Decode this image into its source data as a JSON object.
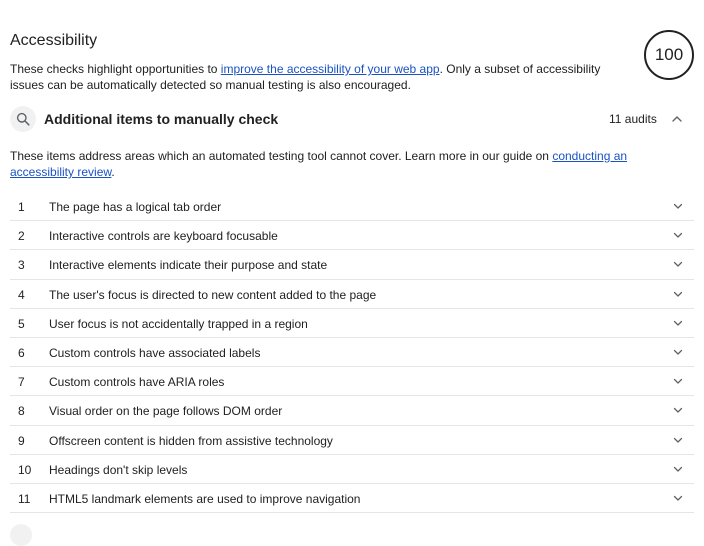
{
  "category": {
    "title": "Accessibility",
    "description_pre": "These checks highlight opportunities to ",
    "description_link": "improve the accessibility of your web app",
    "description_post": ". Only a subset of accessibility issues can be automatically detected so manual testing is also encouraged.",
    "score": "100",
    "score_color": "#212121"
  },
  "group": {
    "icon": "search-icon",
    "title": "Additional items to manually check",
    "count_label": "11 audits",
    "expanded": true,
    "description_pre": "These items address areas which an automated testing tool cannot cover. Learn more in our guide on ",
    "description_link": "conducting an accessibility review",
    "description_post": "."
  },
  "audits": [
    {
      "num": "1",
      "title": "The page has a logical tab order"
    },
    {
      "num": "2",
      "title": "Interactive controls are keyboard focusable"
    },
    {
      "num": "3",
      "title": "Interactive elements indicate their purpose and state"
    },
    {
      "num": "4",
      "title": "The user's focus is directed to new content added to the page"
    },
    {
      "num": "5",
      "title": "User focus is not accidentally trapped in a region"
    },
    {
      "num": "6",
      "title": "Custom controls have associated labels"
    },
    {
      "num": "7",
      "title": "Custom controls have ARIA roles"
    },
    {
      "num": "8",
      "title": "Visual order on the page follows DOM order"
    },
    {
      "num": "9",
      "title": "Offscreen content is hidden from assistive technology"
    },
    {
      "num": "10",
      "title": "Headings don't skip levels"
    },
    {
      "num": "11",
      "title": "HTML5 landmark elements are used to improve navigation"
    }
  ],
  "colors": {
    "link": "#1a52c2",
    "divider": "#e6e6e6",
    "icon_bg": "#f1f1f1"
  }
}
